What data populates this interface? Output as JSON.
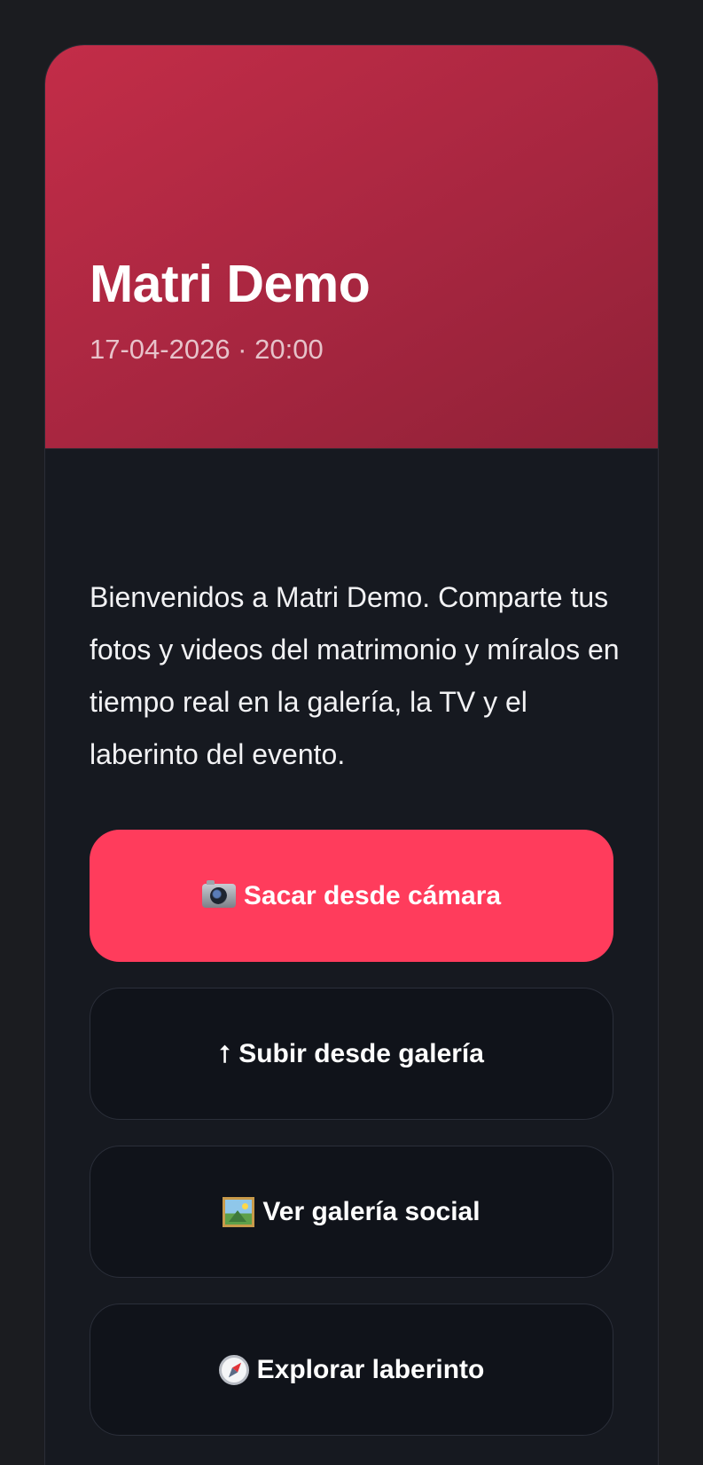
{
  "event": {
    "title": "Matri Demo",
    "datetime": "17-04-2026 · 20:00"
  },
  "intro_text": "Bienvenidos a Matri Demo. Comparte tus fotos y videos del matrimonio y míralos en tiempo real en la galería, la TV y el laberinto del evento.",
  "actions": {
    "camera": {
      "label": "Sacar desde cámara",
      "icon": "camera-icon"
    },
    "upload": {
      "label": "Subir desde galería",
      "icon": "upload-arrow-icon",
      "glyph": "⭡"
    },
    "gallery": {
      "label": "Ver galería social",
      "icon": "framed-picture-icon"
    },
    "maze": {
      "label": "Explorar laberinto",
      "icon": "compass-icon"
    }
  },
  "colors": {
    "background": "#1b1c20",
    "card": "#161920",
    "hero_gradient_start": "#c32d48",
    "hero_gradient_end": "#902137",
    "primary_button": "#ff3c5c",
    "secondary_button": "#10131a",
    "text": "#ffffff"
  }
}
